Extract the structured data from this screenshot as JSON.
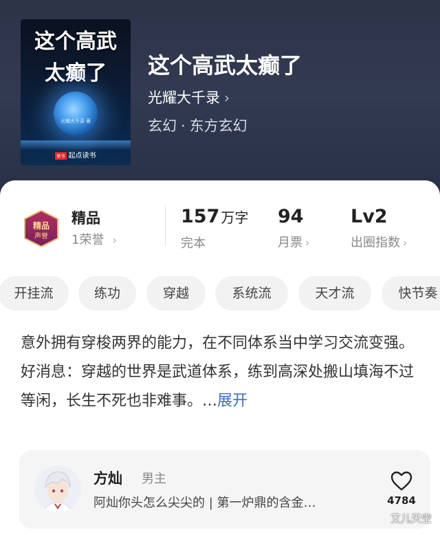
{
  "book": {
    "title": "这个高武太癫了",
    "cover_title_line1": "这个高武",
    "cover_title_line2": "太癫了",
    "cover_author": "光耀大千录 著",
    "cover_brand": "起点读书",
    "cover_brand_badge": "新书",
    "author": "光耀大千录",
    "genre": "玄幻",
    "subgenre": "东方玄幻",
    "genre_separator": "·"
  },
  "stats": {
    "badge_title": "精品",
    "badge_sub": "1荣誉",
    "badge_text": "精品声誉",
    "words_num": "157",
    "words_unit": "万字",
    "words_label": "完本",
    "tickets_num": "94",
    "tickets_label": "月票",
    "level_num": "Lv2",
    "level_label": "出圈指数"
  },
  "tags": [
    "开挂流",
    "练功",
    "穿越",
    "系统流",
    "天才流",
    "快节奏"
  ],
  "description": {
    "para1": "意外拥有穿梭两界的能力，在不同体系当中学习交流变强。",
    "para2": "好消息：穿越的世界是武道体系，练到高深处搬山填海不过等闲，长生不死也非难事。…",
    "more_label": "展开"
  },
  "character": {
    "name": "方灿",
    "role": "男主",
    "desc": "阿灿你头怎么尖尖的 | 第一炉鼎的含金…",
    "likes": "4784"
  },
  "watermark": "艾儿天空",
  "colors": {
    "header_bg": "#2e3347",
    "accent_link": "#3470c8",
    "tag_bg": "#f2f2f3"
  }
}
